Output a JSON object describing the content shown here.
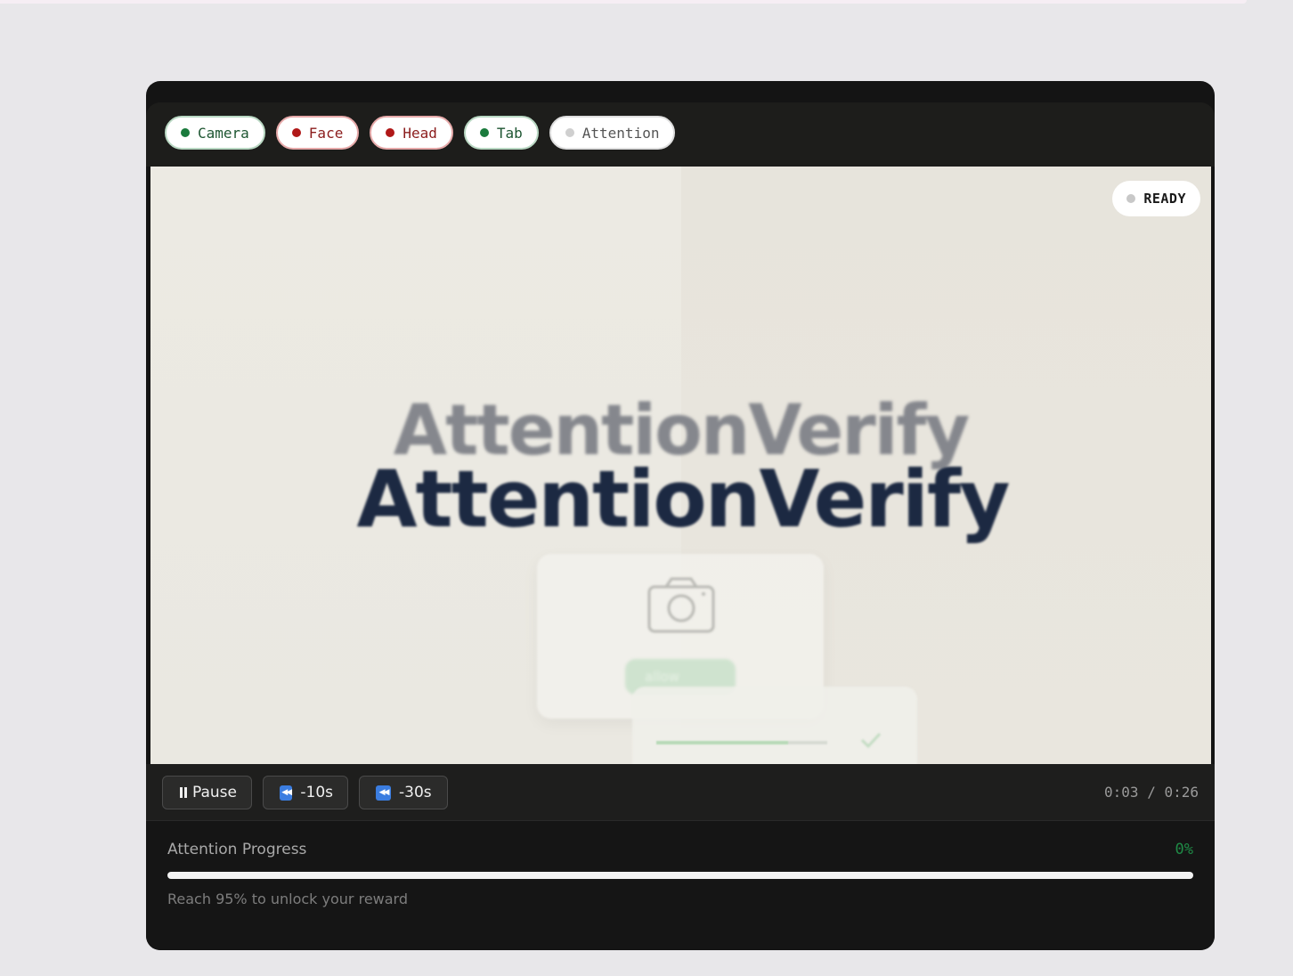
{
  "indicators": [
    {
      "label": "Camera",
      "state": "ok"
    },
    {
      "label": "Face",
      "state": "bad"
    },
    {
      "label": "Head",
      "state": "bad"
    },
    {
      "label": "Tab",
      "state": "ok"
    },
    {
      "label": "Attention",
      "state": "idle"
    }
  ],
  "video": {
    "status": "READY",
    "brand_back": "AttentionVerify",
    "brand_front": "AttentionVerify",
    "allow_label": "allow"
  },
  "controls": {
    "pause_label": "Pause",
    "back10_label": "-10s",
    "back30_label": "-30s",
    "time": "0:03 / 0:26"
  },
  "progress": {
    "label": "Attention Progress",
    "percent_text": "0%",
    "value": 0,
    "hint": "Reach 95% to unlock your reward"
  },
  "colors": {
    "ok": "#1a7a3c",
    "bad": "#b01818",
    "idle": "#cfcfcf",
    "progress": "#1f8a46"
  }
}
